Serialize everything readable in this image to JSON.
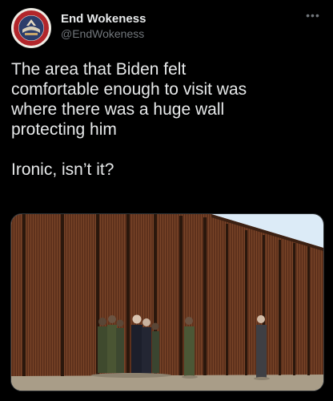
{
  "tweet": {
    "display_name": "End Wokeness",
    "handle": "@EndWokeness",
    "text": "The area that Biden felt\ncomfortable enough to visit was\nwhere there was a huge wall\nprotecting him\n\nIronic, isn’t it?",
    "more_icon": "ellipsis-icon",
    "avatar_icon": "circular-badge-logo"
  },
  "media": {
    "description_icon": "photo-border-wall"
  },
  "colors": {
    "background": "#000000",
    "text": "#e7e9ea",
    "secondary_text": "#71767b",
    "wall": "#6b3a22",
    "sky": "#dcebf7",
    "ground": "#b8ad9a"
  }
}
